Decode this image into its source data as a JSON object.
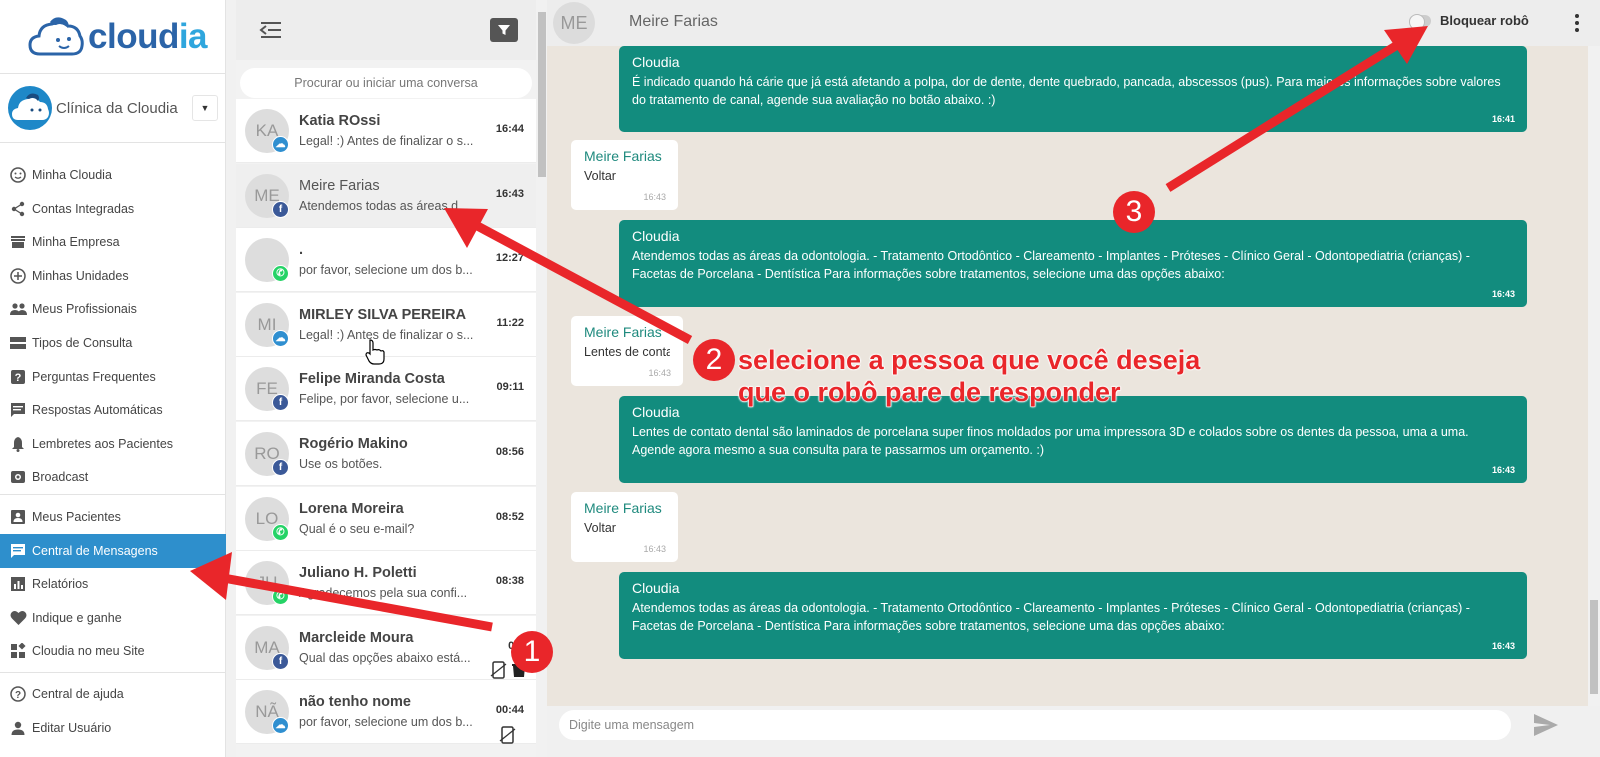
{
  "brand": {
    "part1": "cloud",
    "part2": "ia"
  },
  "clinic": {
    "name": "Clínica da Cloudia"
  },
  "menu": {
    "group1": [
      {
        "label": "Minha Cloudia",
        "icon": "smiley-icon"
      },
      {
        "label": "Contas Integradas",
        "icon": "share-icon"
      },
      {
        "label": "Minha Empresa",
        "icon": "store-icon"
      },
      {
        "label": "Minhas Unidades",
        "icon": "add-circle-icon"
      },
      {
        "label": "Meus Profissionais",
        "icon": "people-icon"
      },
      {
        "label": "Tipos de Consulta",
        "icon": "list-icon"
      },
      {
        "label": "Perguntas Frequentes",
        "icon": "help-box-icon"
      },
      {
        "label": "Respostas Automáticas",
        "icon": "chat-box-icon"
      },
      {
        "label": "Lembretes aos Pacientes",
        "icon": "bell-icon"
      },
      {
        "label": "Broadcast",
        "icon": "broadcast-icon"
      }
    ],
    "group2": [
      {
        "label": "Meus Pacientes",
        "icon": "contacts-icon"
      },
      {
        "label": "Central de Mensagens",
        "icon": "message-icon",
        "active": true
      },
      {
        "label": "Relatórios",
        "icon": "bar-chart-icon"
      },
      {
        "label": "Indique e ganhe",
        "icon": "heart-icon"
      },
      {
        "label": "Cloudia no meu Site",
        "icon": "widgets-icon"
      }
    ],
    "group3": [
      {
        "label": "Central de ajuda",
        "icon": "help-circle-icon"
      },
      {
        "label": "Editar Usuário",
        "icon": "person-icon"
      }
    ]
  },
  "conversations": {
    "search_placeholder": "Procurar ou iniciar uma conversa",
    "items": [
      {
        "initials": "KA",
        "name": "Katia ROssi",
        "preview": "Legal! :) Antes de finalizar o s...",
        "time": "16:44",
        "channel": "cloudia"
      },
      {
        "initials": "ME",
        "name": "Meire Farias",
        "preview": "Atendemos todas as áreas d...",
        "time": "16:43",
        "channel": "facebook",
        "selected": true
      },
      {
        "initials": "",
        "name": ".",
        "preview": "por favor, selecione um dos b...",
        "time": "12:27",
        "channel": "whatsapp"
      },
      {
        "initials": "MI",
        "name": "MIRLEY SILVA PEREIRA",
        "preview": "Legal! :) Antes de finalizar o s...",
        "time": "11:22",
        "channel": "cloudia"
      },
      {
        "initials": "FE",
        "name": "Felipe Miranda Costa",
        "preview": "Felipe, por favor, selecione u...",
        "time": "09:11",
        "channel": "facebook"
      },
      {
        "initials": "RO",
        "name": "Rogério Makino",
        "preview": "Use os botões.",
        "time": "08:56",
        "channel": "facebook"
      },
      {
        "initials": "LO",
        "name": "Lorena Moreira",
        "preview": "Qual é o seu e-mail?",
        "time": "08:52",
        "channel": "whatsapp"
      },
      {
        "initials": "JU",
        "name": "Juliano H. Poletti",
        "preview": "Agradecemos pela sua confi...",
        "time": "08:38",
        "channel": "whatsapp"
      },
      {
        "initials": "MA",
        "name": "Marcleide Moura",
        "preview": "Qual das opções abaixo está...",
        "time": "00:",
        "channel": "facebook"
      },
      {
        "initials": "NÃ",
        "name": "não tenho nome",
        "preview": "por favor, selecione um dos b...",
        "time": "00:44",
        "channel": "cloudia"
      }
    ]
  },
  "chat": {
    "contact_initials": "ME",
    "contact_name": "Meire Farias",
    "block_label": "Bloquear robô",
    "composer_placeholder": "Digite uma mensagem",
    "messages": [
      {
        "dir": "out",
        "sender": "Cloudia",
        "text": "É indicado quando há cárie que já está afetando a polpa, dor de dente, dente quebrado, pancada, abscessos (pus). Para maiores informações sobre valores do tratamento de canal, agende sua avaliação no botão abaixo. :)",
        "time": "16:41"
      },
      {
        "dir": "in",
        "sender": "Meire Farias",
        "text": "Voltar",
        "time": "16:43"
      },
      {
        "dir": "out",
        "sender": "Cloudia",
        "text": "Atendemos todas as áreas da odontologia. - Tratamento Ortodôntico - Clareamento - Implantes - Próteses - Clínico Geral - Odontopediatria (crianças) - Facetas de Porcelana - Dentística Para informações sobre tratamentos, selecione uma das opções abaixo:",
        "time": "16:43"
      },
      {
        "dir": "in",
        "sender": "Meire Farias",
        "text": "Lentes de contato",
        "time": "16:43"
      },
      {
        "dir": "out",
        "sender": "Cloudia",
        "text": "Lentes de contato dental são laminados de porcelana super finos moldados por uma impressora 3D e colados sobre os dentes da pessoa, uma a uma. Agende agora mesmo a sua consulta para te passarmos um orçamento. :)",
        "time": "16:43"
      },
      {
        "dir": "in",
        "sender": "Meire Farias",
        "text": "Voltar",
        "time": "16:43"
      },
      {
        "dir": "out",
        "sender": "Cloudia",
        "text": "Atendemos todas as áreas da odontologia. - Tratamento Ortodôntico - Clareamento - Implantes - Próteses - Clínico Geral - Odontopediatria (crianças) - Facetas de Porcelana - Dentística Para informações sobre tratamentos, selecione uma das opções abaixo:",
        "time": "16:43"
      }
    ]
  },
  "annotations": {
    "step1": "1",
    "step2": "2",
    "step3": "3",
    "note_line1": "selecione a pessoa que você deseja",
    "note_line2": "que o robô pare de responder",
    "color": "#e9262a"
  }
}
